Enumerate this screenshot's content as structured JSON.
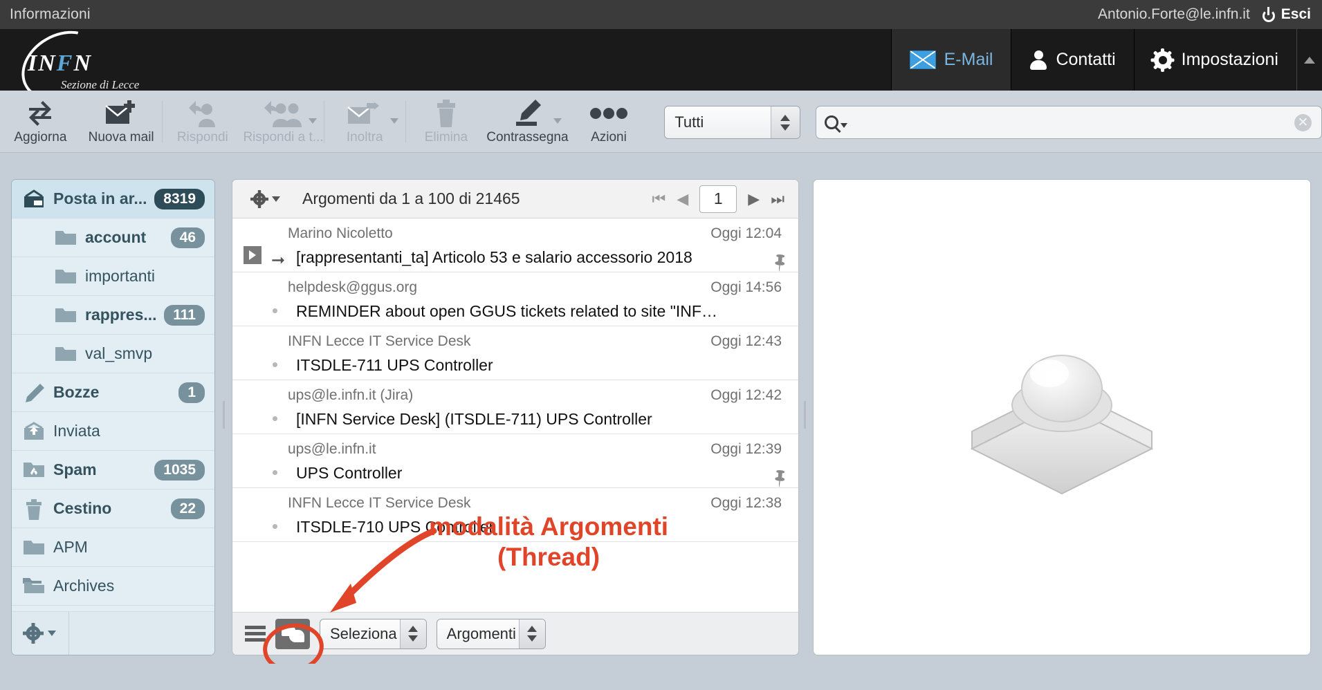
{
  "topbar": {
    "info_label": "Informazioni",
    "user_email": "Antonio.Forte@le.infn.it",
    "logout_label": "Esci",
    "power_icon": "power-icon"
  },
  "navbar": {
    "brand_name": "INFN",
    "brand_sub": "Sezione di Lecce",
    "items": [
      {
        "label": "E-Mail",
        "icon": "mail-icon",
        "active": true
      },
      {
        "label": "Contatti",
        "icon": "user-icon",
        "active": false
      },
      {
        "label": "Impostazioni",
        "icon": "gear-icon",
        "active": false
      }
    ],
    "scroll_icon": "chevron-up-icon"
  },
  "toolbar": {
    "buttons": [
      {
        "label": "Aggiorna",
        "icon": "refresh-icon",
        "disabled": false,
        "caret": false
      },
      {
        "label": "Nuova mail",
        "icon": "new-mail-icon",
        "disabled": false,
        "caret": false
      },
      {
        "label": "Rispondi",
        "icon": "reply-icon",
        "disabled": true,
        "caret": false
      },
      {
        "label": "Rispondi a t...",
        "icon": "reply-all-icon",
        "disabled": true,
        "caret": true
      },
      {
        "label": "Inoltra",
        "icon": "forward-icon",
        "disabled": true,
        "caret": true
      },
      {
        "label": "Elimina",
        "icon": "trash-icon",
        "disabled": true,
        "caret": false
      },
      {
        "label": "Contrassegna",
        "icon": "marker-pen-icon",
        "disabled": false,
        "caret": true
      },
      {
        "label": "Azioni",
        "icon": "ellipsis-icon",
        "disabled": false,
        "caret": false
      }
    ],
    "scope_value": "Tutti",
    "search_placeholder": "",
    "search_value": "",
    "search_icon": "search-icon",
    "clear_icon": "clear-icon"
  },
  "sidebar": {
    "folders": [
      {
        "name": "Posta in ar...",
        "badge": "8319",
        "icon": "inbox-icon",
        "selected": true,
        "child": false,
        "bold": true,
        "badge_dark": true
      },
      {
        "name": "account",
        "badge": "46",
        "icon": "folder-icon",
        "selected": false,
        "child": true,
        "bold": true,
        "badge_dark": false
      },
      {
        "name": "importanti",
        "badge": "",
        "icon": "folder-icon",
        "selected": false,
        "child": true,
        "bold": false,
        "badge_dark": false
      },
      {
        "name": "rappres...",
        "badge": "111",
        "icon": "folder-icon",
        "selected": false,
        "child": true,
        "bold": true,
        "badge_dark": false
      },
      {
        "name": "val_smvp",
        "badge": "",
        "icon": "folder-icon",
        "selected": false,
        "child": true,
        "bold": false,
        "badge_dark": false
      },
      {
        "name": "Bozze",
        "badge": "1",
        "icon": "pencil-icon",
        "selected": false,
        "child": false,
        "bold": true,
        "badge_dark": false
      },
      {
        "name": "Inviata",
        "badge": "",
        "icon": "sent-icon",
        "selected": false,
        "child": false,
        "bold": false,
        "badge_dark": false
      },
      {
        "name": "Spam",
        "badge": "1035",
        "icon": "junk-icon",
        "selected": false,
        "child": false,
        "bold": true,
        "badge_dark": false
      },
      {
        "name": "Cestino",
        "badge": "22",
        "icon": "trash-icon",
        "selected": false,
        "child": false,
        "bold": true,
        "badge_dark": false
      },
      {
        "name": "APM",
        "badge": "",
        "icon": "folder-icon",
        "selected": false,
        "child": false,
        "bold": false,
        "badge_dark": false
      },
      {
        "name": "Archives",
        "badge": "",
        "icon": "folder-stack-icon",
        "selected": false,
        "child": false,
        "bold": false,
        "badge_dark": false
      }
    ],
    "footer_gear_icon": "gear-icon"
  },
  "maillist": {
    "gear_icon": "gear-icon",
    "count_text": "Argomenti da 1 a 100 di 21465",
    "page_value": "1",
    "pager": {
      "first_icon": "first-page-icon",
      "prev_icon": "prev-page-icon",
      "next_icon": "next-page-icon",
      "last_icon": "last-page-icon"
    },
    "rows": [
      {
        "from": "Marino Nicoletto",
        "date": "Oggi 12:04",
        "subject": "[rappresentanti_ta] Articolo 53 e salario accessorio 2018",
        "thread": true,
        "arrow": true,
        "attachment": true
      },
      {
        "from": "helpdesk@ggus.org",
        "date": "Oggi 14:56",
        "subject": "REMINDER about open GGUS tickets related to site \"INF…",
        "thread": false,
        "arrow": false,
        "attachment": false
      },
      {
        "from": "INFN Lecce IT Service Desk",
        "date": "Oggi 12:43",
        "subject": "ITSDLE-711 UPS Controller",
        "thread": false,
        "arrow": false,
        "attachment": false
      },
      {
        "from": "ups@le.infn.it (Jira)",
        "date": "Oggi 12:42",
        "subject": "[INFN Service Desk] (ITSDLE-711) UPS Controller",
        "thread": false,
        "arrow": false,
        "attachment": false
      },
      {
        "from": "ups@le.infn.it",
        "date": "Oggi 12:39",
        "subject": "UPS Controller",
        "thread": false,
        "arrow": false,
        "attachment": true
      },
      {
        "from": "INFN Lecce IT Service Desk",
        "date": "Oggi 12:38",
        "subject": "ITSDLE-710 UPS Controller",
        "thread": false,
        "arrow": false,
        "attachment": false
      }
    ],
    "footer": {
      "list_options_icon": "hamburger-icon",
      "thread_mode_icon": "conversation-icon",
      "select_label": "Seleziona",
      "sort_label": "Argomenti"
    }
  },
  "annotation": {
    "text": "modalità Argomenti\n(Thread)",
    "color": "#e0452a"
  },
  "preview": {
    "placeholder_icon": "mail-app-3d-icon"
  }
}
